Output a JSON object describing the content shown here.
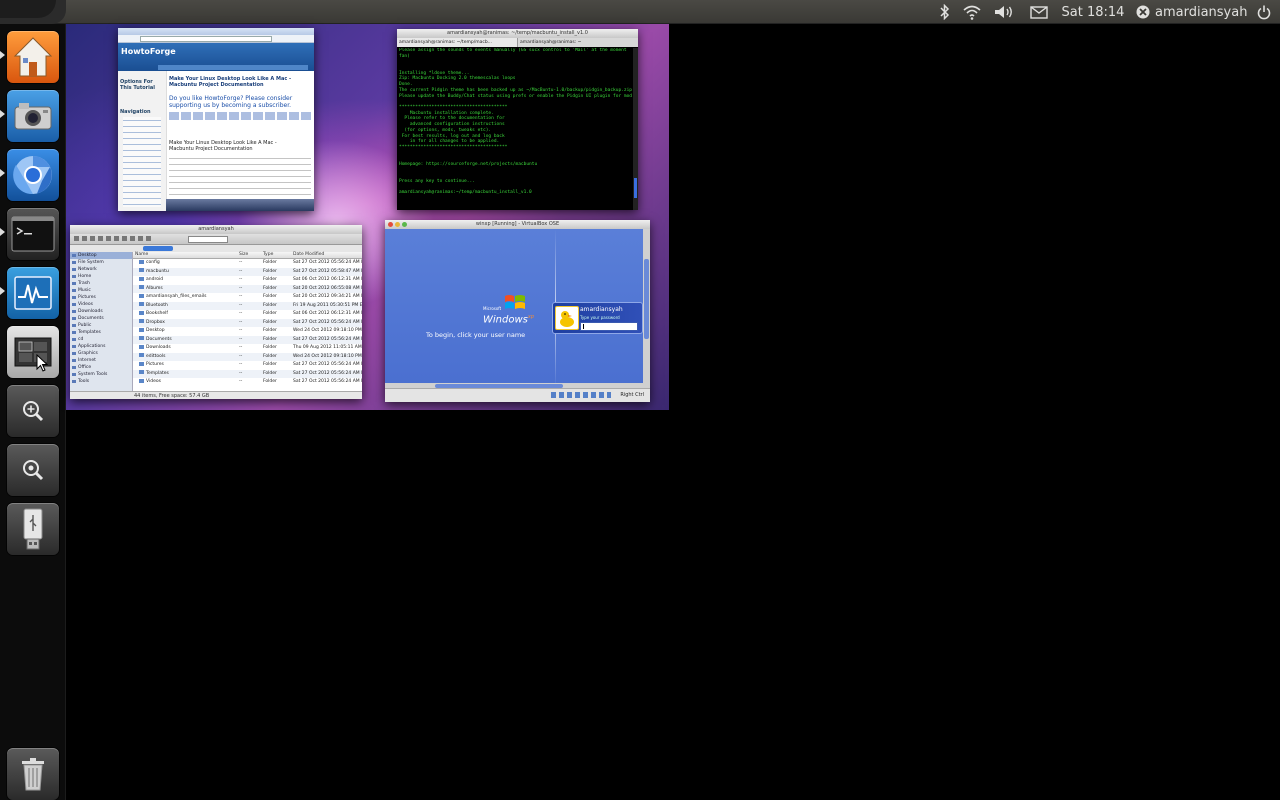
{
  "top_panel": {
    "clock": "Sat 18:14",
    "username": "amardiansyah",
    "icons": [
      "bluetooth-icon",
      "wifi-icon",
      "volume-icon",
      "mail-icon",
      "user-x-icon",
      "power-icon"
    ]
  },
  "launcher": {
    "items": [
      {
        "name": "home-folder-icon",
        "running": true
      },
      {
        "name": "camera-icon",
        "running": true
      },
      {
        "name": "chromium-icon",
        "running": true
      },
      {
        "name": "terminal-icon",
        "running": true
      },
      {
        "name": "system-monitor-icon",
        "running": true
      },
      {
        "name": "workspace-switcher-icon",
        "running": false
      },
      {
        "name": "zoom-in-icon",
        "running": false
      },
      {
        "name": "zoom-out-icon",
        "running": false
      },
      {
        "name": "usb-drive-icon",
        "running": false
      },
      {
        "name": "trash-icon",
        "running": false
      }
    ]
  },
  "windows": {
    "browser": {
      "site_name": "HowtoForge",
      "heading": "Make Your Linux Desktop Look Like A Mac - Macbuntu Project Documentation",
      "banner": "Do you like HowtoForge? Please consider supporting us by becoming a subscriber.",
      "sub_heading": "Make Your Linux Desktop Look Like A Mac - Macbuntu Project Documentation",
      "sidebar_title": "Options For This Tutorial",
      "nav_title": "Navigation"
    },
    "terminal": {
      "title": "amardiansyah@ranimas: ~/temp/macbuntu_install_v1.0",
      "tab1": "amardiansyah@ranimas: ~/temp/macb...",
      "tab2": "amardiansyah@ranimas: ~",
      "lines": [
        "Please assign the sounds to events manually (GS sucx control to 'Mail' at the moment",
        "fan)",
        "",
        "",
        "Installing *ldoxe theme...",
        "Zip: Macbuntu Docking 2.0 themescalas loops",
        "Done.",
        "The current Pidgin theme has been backed up as ~/MacBuntu-1.0/backup/pidgin_backup.zip",
        "Please update the Buddy/Chat status using prefs or enable the Pidgin UI plugin for modules i",
        "",
        "****************************************",
        "    Macbuntu installation complete.",
        "  Please refer to the documentation for",
        "    advanced configuration instructions",
        "  (for options, mods, tweaks etc).",
        " For best results, log out and log back",
        "    in for all changes to be applied.",
        "****************************************",
        "",
        "",
        "Homepage: https://sourceforge.net/projects/macbuntu",
        "",
        "",
        "Press any key to continue...",
        "",
        "amardiansyah@ranimas:~/temp/macbuntu_install_v1.0"
      ]
    },
    "file_manager": {
      "title": "amardiansyah",
      "columns": [
        "Name",
        "Size",
        "Type",
        "Date Modified"
      ],
      "sidebar_items": [
        "Desktop",
        "File System",
        "Network",
        "Home",
        "Trash",
        "Music",
        "Pictures",
        "Videos",
        "Downloads",
        "Documents",
        "Public",
        "Templates",
        "cd",
        "Applications",
        "Graphics",
        "Internet",
        "Office",
        "System Tools",
        "Tools"
      ],
      "rows": [
        {
          "name": "config",
          "size": "--",
          "type": "Folder",
          "date": "Sat 27 Oct 2012 05:56:24 AM EST"
        },
        {
          "name": "macbuntu",
          "size": "--",
          "type": "Folder",
          "date": "Sat 27 Oct 2012 05:58:47 AM EST"
        },
        {
          "name": "android",
          "size": "--",
          "type": "Folder",
          "date": "Sat 06 Oct 2012 06:12:31 AM EST"
        },
        {
          "name": "Albums",
          "size": "--",
          "type": "Folder",
          "date": "Sat 20 Oct 2012 06:55:08 AM EST"
        },
        {
          "name": "amardiansyah_files_emails",
          "size": "--",
          "type": "Folder",
          "date": "Sat 20 Oct 2012 09:34:21 AM EST"
        },
        {
          "name": "Bluetooth",
          "size": "--",
          "type": "Folder",
          "date": "Fri 19 Aug 2011 05:30:51 PM EST"
        },
        {
          "name": "Bookshelf",
          "size": "--",
          "type": "Folder",
          "date": "Sat 06 Oct 2012 06:12:31 AM EST"
        },
        {
          "name": "Dropbox",
          "size": "--",
          "type": "Folder",
          "date": "Sat 27 Oct 2012 05:56:24 AM EST"
        },
        {
          "name": "Desktop",
          "size": "--",
          "type": "Folder",
          "date": "Wed 24 Oct 2012 09:18:10 PM EST"
        },
        {
          "name": "Documents",
          "size": "--",
          "type": "Folder",
          "date": "Sat 27 Oct 2012 05:56:24 AM EST"
        },
        {
          "name": "Downloads",
          "size": "--",
          "type": "Folder",
          "date": "Thu 09 Aug 2012 11:05:11 AM EST"
        },
        {
          "name": "edittools",
          "size": "--",
          "type": "Folder",
          "date": "Wed 24 Oct 2012 09:18:10 PM EST"
        },
        {
          "name": "Pictures",
          "size": "--",
          "type": "Folder",
          "date": "Sat 27 Oct 2012 05:56:24 AM EST"
        },
        {
          "name": "Templates",
          "size": "--",
          "type": "Folder",
          "date": "Sat 27 Oct 2012 05:56:24 AM EST"
        },
        {
          "name": "Videos",
          "size": "--",
          "type": "Folder",
          "date": "Sat 27 Oct 2012 05:56:24 AM EST"
        }
      ],
      "status": "44 items, Free space: 57.4 GB"
    },
    "virtualbox": {
      "title": "winxp [Running] - VirtualBox OSE",
      "windows_label_small": "Microsoft",
      "windows_label": "Windows",
      "windows_suffix": "xp",
      "begin_text": "To begin, click your user name",
      "user_name": "amardiansyah",
      "password_hint": "Type your password",
      "host_key": "Right Ctrl"
    }
  }
}
